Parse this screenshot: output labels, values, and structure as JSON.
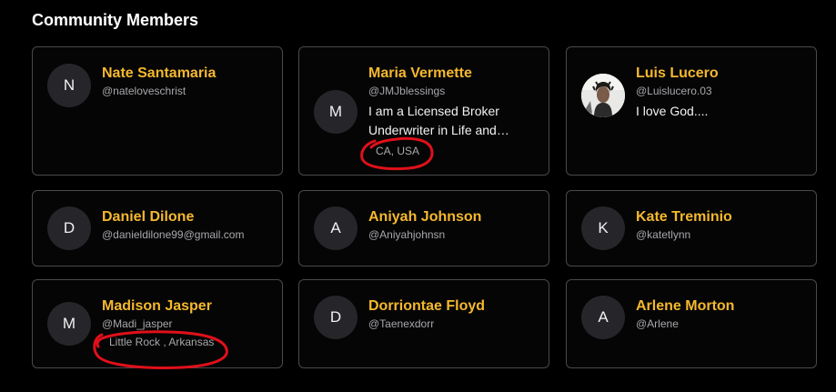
{
  "section": {
    "title": "Community Members"
  },
  "members": [
    {
      "name": "Nate Santamaria",
      "handle": "@nateloveschrist",
      "avatar_initial": "N"
    },
    {
      "name": "Maria Vermette",
      "handle": "@JMJblessings",
      "bio": "I am a Licensed Broker Underwriter in Life and Health Insurance",
      "location": "CA, USA",
      "avatar_initial": "M"
    },
    {
      "name": "Luis Lucero",
      "handle": "@Luislucero.03",
      "bio": "I love God....",
      "avatar": "profile-photo"
    },
    {
      "name": "Daniel Dilone",
      "handle": "@danieldilone99@gmail.com",
      "avatar_initial": "D"
    },
    {
      "name": "Aniyah Johnson",
      "handle": "@Aniyahjohnsn",
      "avatar_initial": "A"
    },
    {
      "name": "Kate Treminio",
      "handle": "@katetlynn",
      "avatar_initial": "K"
    },
    {
      "name": "Madison Jasper",
      "handle": "@Madi_jasper",
      "location": "Little Rock , Arkansas",
      "avatar_initial": "M"
    },
    {
      "name": "Dorriontae Floyd",
      "handle": "@Taenexdorr",
      "avatar_initial": "D"
    },
    {
      "name": "Arlene Morton",
      "handle": "@Arlene",
      "avatar_initial": "A"
    }
  ],
  "colors": {
    "background": "#000000",
    "card_border": "#4a4a4e",
    "name": "#f5b82e",
    "handle": "#a8a8ad",
    "annotation_ink": "#e0101a"
  }
}
